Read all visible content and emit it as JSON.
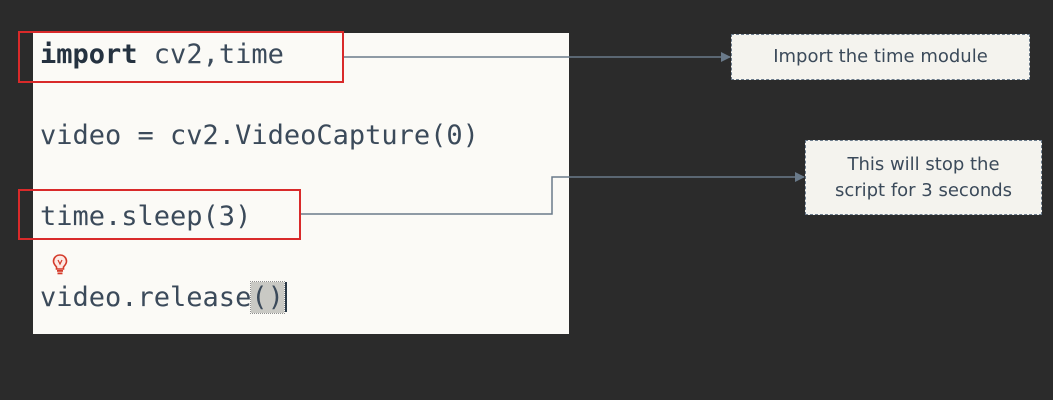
{
  "code": {
    "line1_keyword": "import",
    "line1_rest": " cv2,time",
    "line2": "video = cv2.VideoCapture(0)",
    "line3": "time.sleep(3)",
    "line4_prefix": "video.release",
    "line4_parens": "()"
  },
  "callouts": {
    "import_note": "Import the time module",
    "sleep_note_line1": "This will stop the",
    "sleep_note_line2": "script for 3 seconds"
  },
  "colors": {
    "background": "#2b2b2b",
    "editor": "#fbfaf6",
    "highlight_box": "#d92a2a",
    "connector": "#6a7a8a",
    "text": "#3b4a5a"
  },
  "icons": {
    "bulb": "lightbulb-icon"
  }
}
